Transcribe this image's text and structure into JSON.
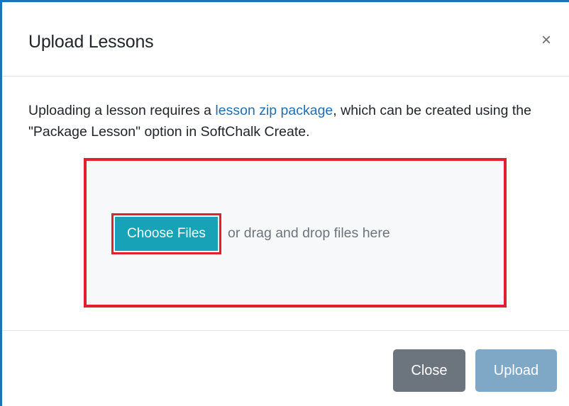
{
  "dialog": {
    "title": "Upload Lessons",
    "close_symbol": "×"
  },
  "body": {
    "text_before_link": "Uploading a lesson requires a ",
    "link_text": "lesson zip package",
    "text_after_link": ", which can be created using the \"Package Lesson\" option in SoftChalk Create."
  },
  "dropzone": {
    "choose_label": "Choose Files",
    "hint": "or drag and drop files here"
  },
  "footer": {
    "close_label": "Close",
    "upload_label": "Upload"
  },
  "colors": {
    "accent": "#17a2b8",
    "highlight": "#e0202e",
    "close_button": "#6c757d",
    "upload_button_disabled": "#7fa7c6",
    "link": "#1f6fb2"
  },
  "icons": {
    "dialog_close": "close-icon"
  }
}
